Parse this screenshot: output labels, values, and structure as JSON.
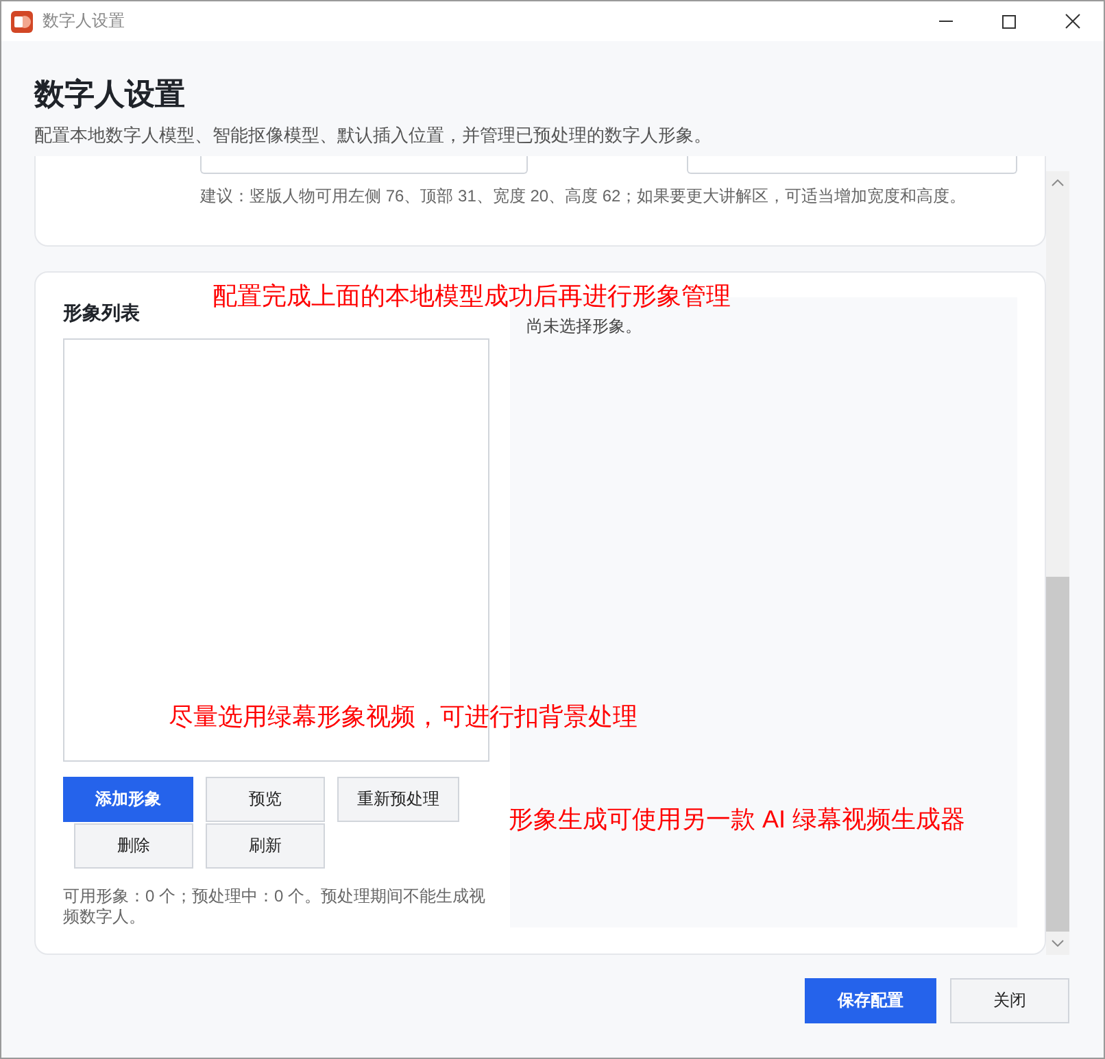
{
  "window": {
    "title": "数字人设置"
  },
  "header": {
    "title": "数字人设置",
    "subtitle": "配置本地数字人模型、智能抠像模型、默认插入位置，并管理已预处理的数字人形象。"
  },
  "model_card": {
    "hint": "建议：竖版人物可用左侧 76、顶部 31、宽度 20、高度 62；如果要更大讲解区，可适当增加宽度和高度。"
  },
  "avatar_card": {
    "title": "形象列表",
    "buttons": [
      {
        "label": "添加形象",
        "kind": "primary"
      },
      {
        "label": "预览",
        "kind": "default"
      },
      {
        "label": "重新预处理",
        "kind": "default"
      },
      {
        "label": "删除",
        "kind": "default"
      },
      {
        "label": "刷新",
        "kind": "default"
      }
    ],
    "status": "可用形象：0 个；预处理中：0 个。预处理期间不能生成视频数字人。",
    "detail": {
      "message": "尚未选择形象。"
    }
  },
  "annotations": [
    {
      "text": "配置完成上面的本地模型成功后再进行形象管理"
    },
    {
      "text": "尽量选用绿幕形象视频，可进行扣背景处理"
    },
    {
      "text": "形象生成可使用另一款 AI 绿幕视频生成器"
    }
  ],
  "footer": {
    "buttons": [
      {
        "label": "保存配置",
        "kind": "primary"
      },
      {
        "label": "关闭",
        "kind": "default"
      }
    ]
  }
}
